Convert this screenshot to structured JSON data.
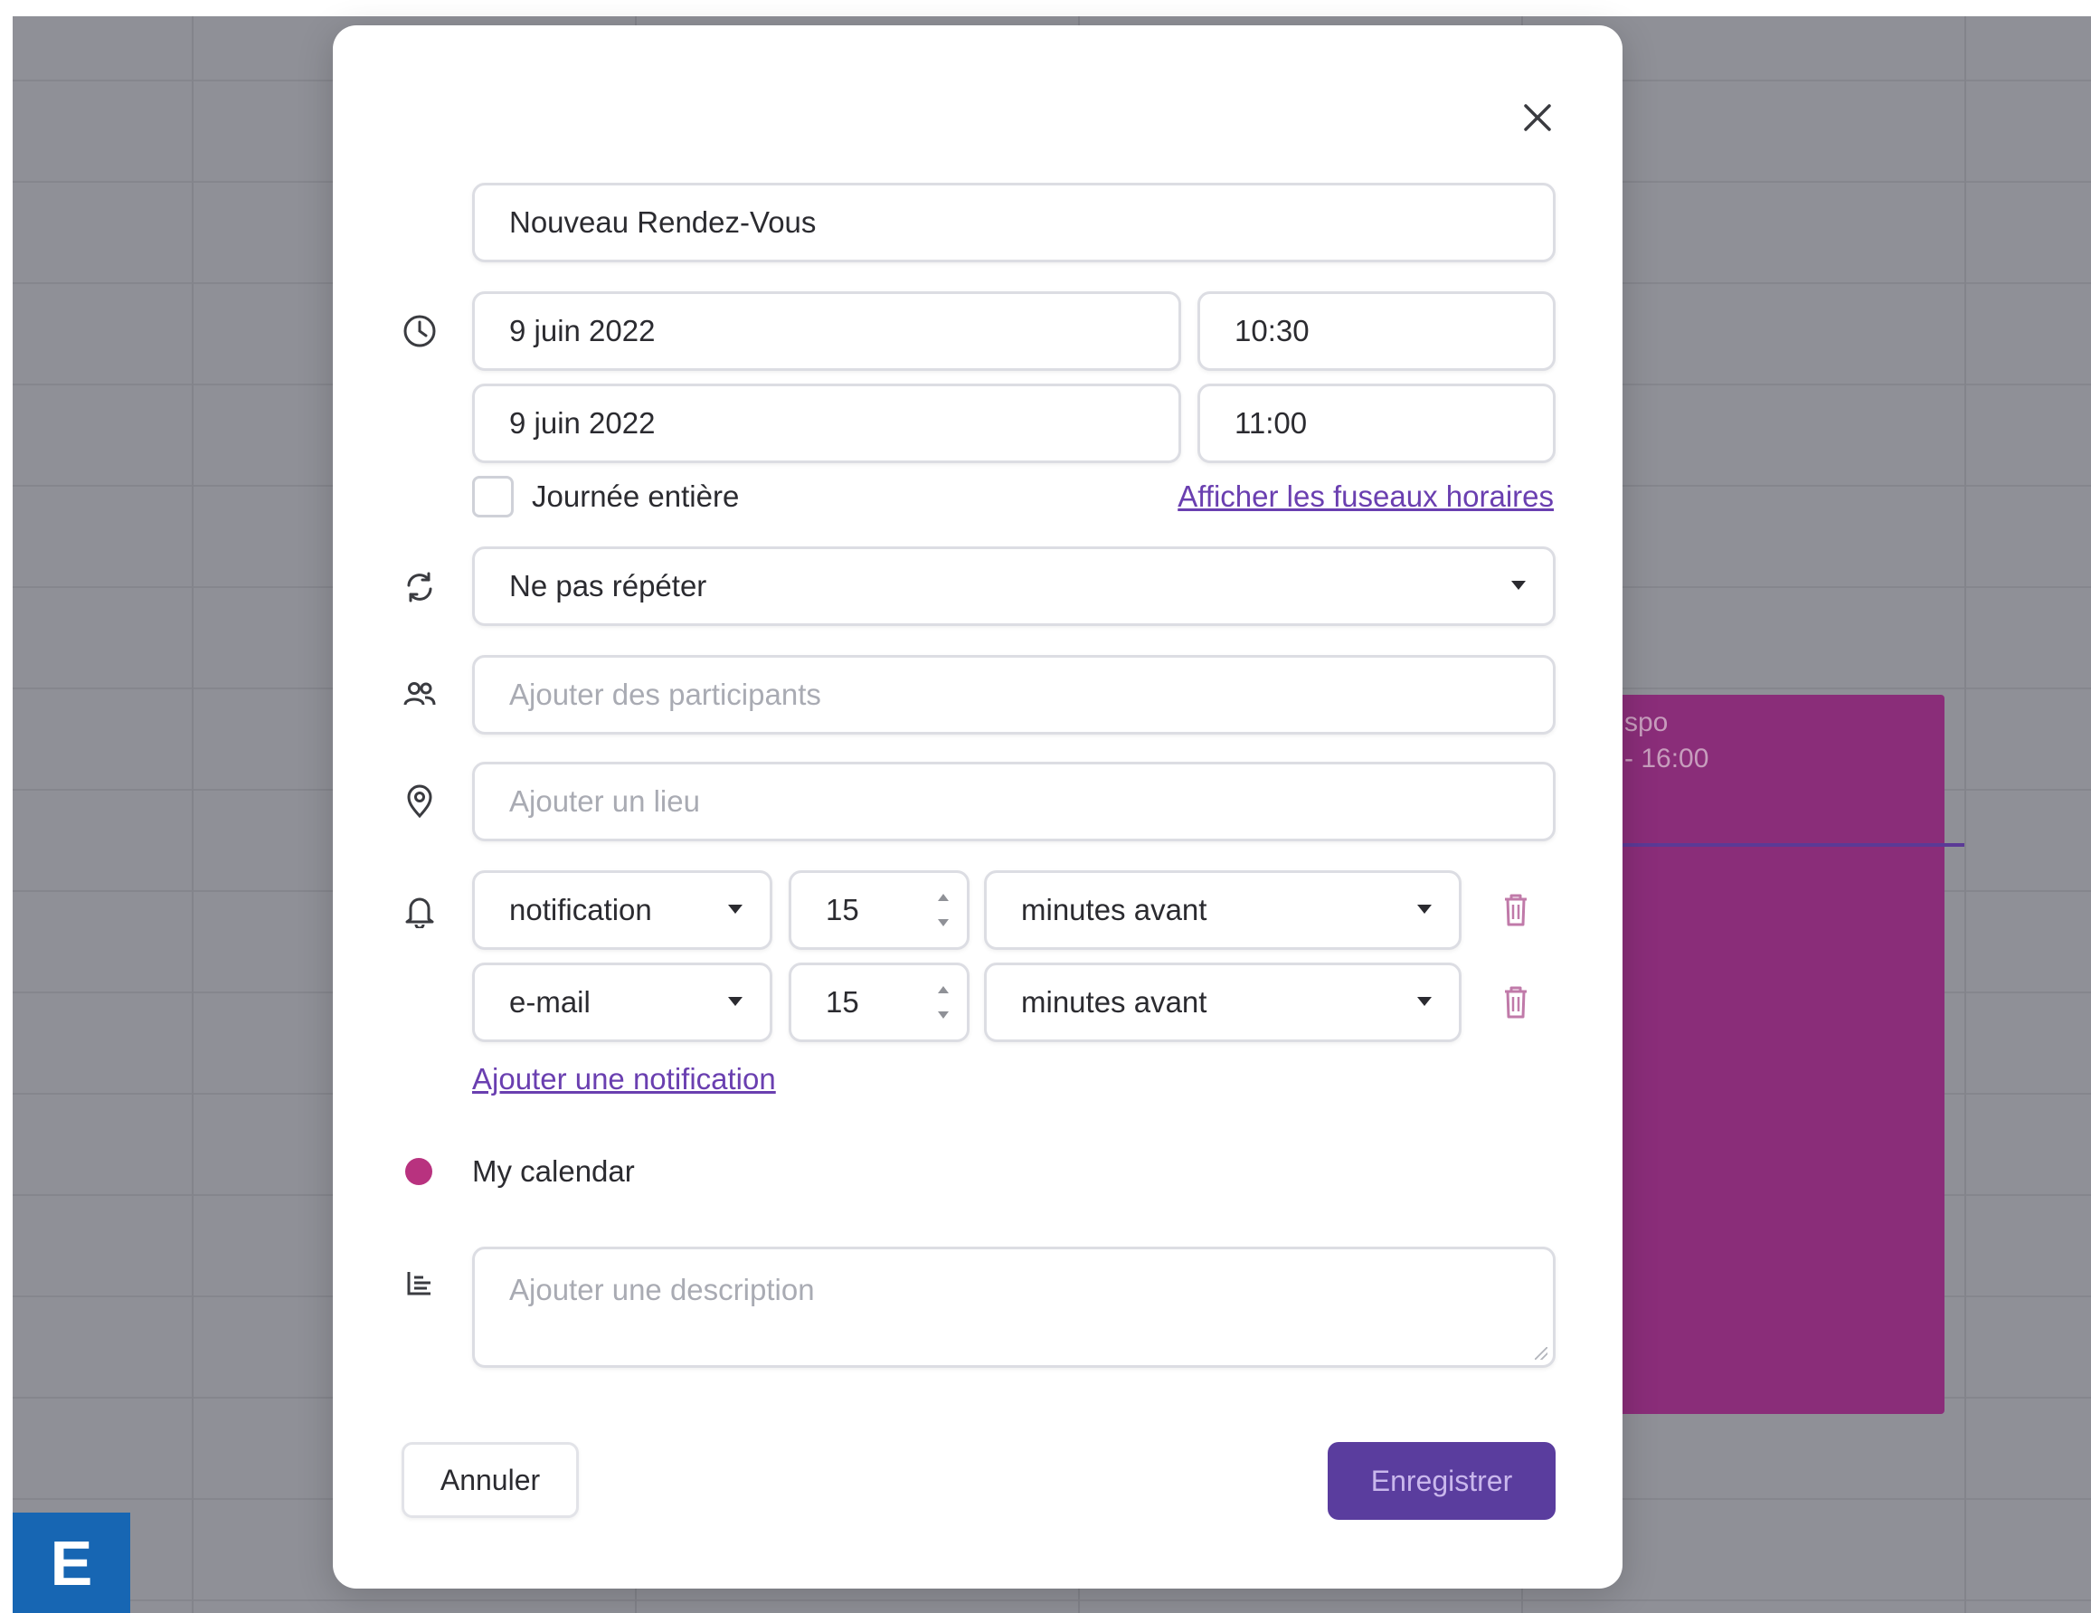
{
  "background": {
    "event": {
      "title": "spo",
      "time": "- 16:00",
      "color": "#8a2d79"
    },
    "badge_letter": "E"
  },
  "modal": {
    "title_value": "Nouveau Rendez-Vous",
    "start": {
      "date": "9 juin 2022",
      "time": "10:30"
    },
    "end": {
      "date": "9 juin 2022",
      "time": "11:00"
    },
    "all_day_label": "Journée entière",
    "timezones_link": "Afficher les fuseaux horaires",
    "repeat_value": "Ne pas répéter",
    "participants_placeholder": "Ajouter des participants",
    "location_placeholder": "Ajouter un lieu",
    "notifications": [
      {
        "type": "notification",
        "amount": "15",
        "unit": "minutes avant"
      },
      {
        "type": "e-mail",
        "amount": "15",
        "unit": "minutes avant"
      }
    ],
    "add_notification_link": "Ajouter une notification",
    "calendar_name": "My calendar",
    "calendar_color": "#b8327f",
    "description_placeholder": "Ajouter une description",
    "cancel_label": "Annuler",
    "save_label": "Enregistrer"
  },
  "icons": [
    "close-icon",
    "clock-icon",
    "repeat-icon",
    "participants-icon",
    "location-pin-icon",
    "bell-icon",
    "trash-icon",
    "description-icon"
  ],
  "colors": {
    "accent": "#5a3d9e",
    "link": "#6a3fb0",
    "overlay_bg": "#8f9097"
  }
}
